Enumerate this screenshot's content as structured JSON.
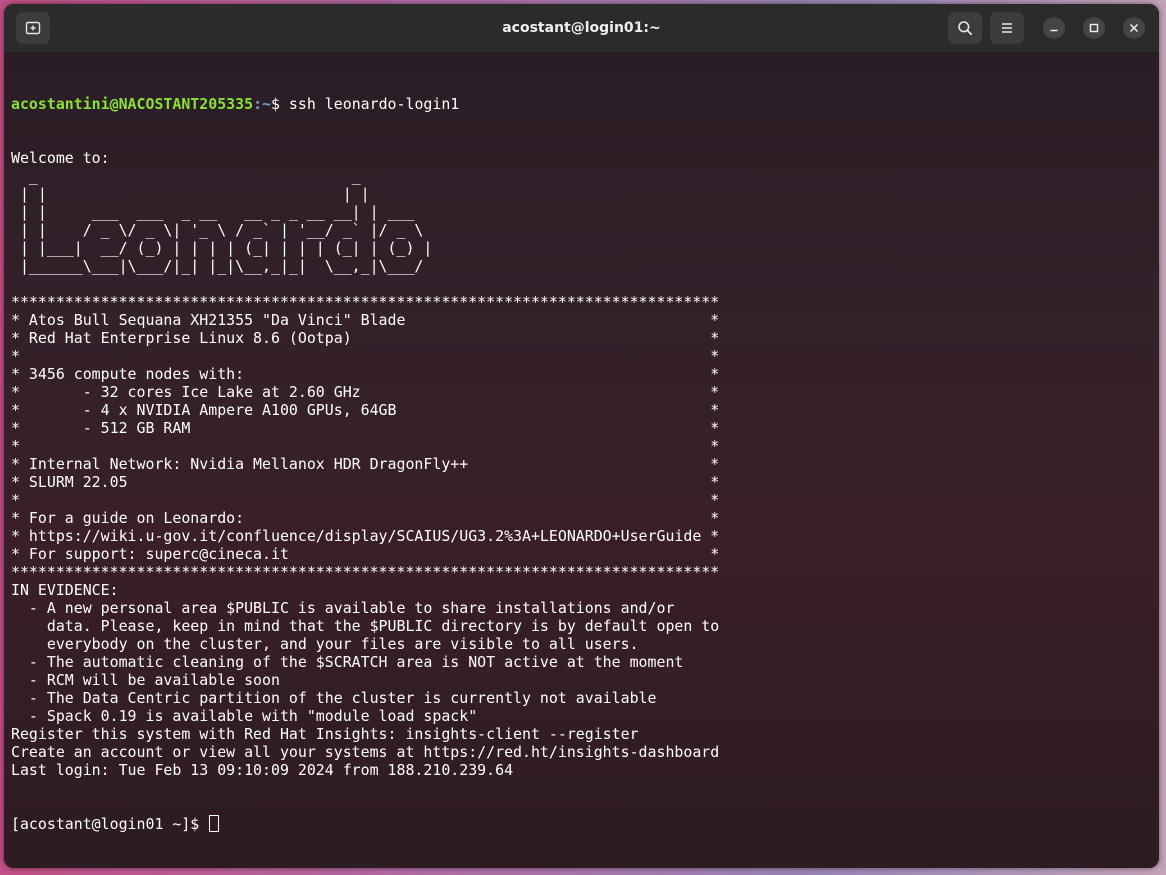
{
  "window": {
    "title": "acostant@login01:~"
  },
  "prompt": {
    "user_host": "acostantini@NACOSTANT205335",
    "path": ":~",
    "symbol": "$",
    "command": " ssh leonardo-login1"
  },
  "output_lines": [
    "Welcome to:",
    "  _                                   _",
    " | |                                 | |",
    " | |     ___  ___  _ __   __ _ _ __ __| | ___",
    " | |    / _ \\/ _ \\| '_ \\ / _` | '__/ _` |/ _ \\",
    " | |___|  __/ (_) | | | | (_| | | | (_| | (_) |",
    " |______\\___|\\___/|_| |_|\\__,_|_|  \\__,_|\\___/",
    "",
    "*******************************************************************************",
    "* Atos Bull Sequana XH21355 \"Da Vinci\" Blade                                  *",
    "* Red Hat Enterprise Linux 8.6 (Ootpa)                                        *",
    "*                                                                             *",
    "* 3456 compute nodes with:                                                    *",
    "*       - 32 cores Ice Lake at 2.60 GHz                                       *",
    "*       - 4 x NVIDIA Ampere A100 GPUs, 64GB                                   *",
    "*       - 512 GB RAM                                                          *",
    "*                                                                             *",
    "* Internal Network: Nvidia Mellanox HDR DragonFly++                           *",
    "* SLURM 22.05                                                                 *",
    "*                                                                             *",
    "* For a guide on Leonardo:                                                    *",
    "* https://wiki.u-gov.it/confluence/display/SCAIUS/UG3.2%3A+LEONARDO+UserGuide *",
    "* For support: superc@cineca.it                                               *",
    "*******************************************************************************",
    "IN EVIDENCE:",
    "  - A new personal area $PUBLIC is available to share installations and/or",
    "    data. Please, keep in mind that the $PUBLIC directory is by default open to",
    "    everybody on the cluster, and your files are visible to all users.",
    "  - The automatic cleaning of the $SCRATCH area is NOT active at the moment",
    "  - RCM will be available soon",
    "  - The Data Centric partition of the cluster is currently not available",
    "  - Spack 0.19 is available with \"module load spack\"",
    "Register this system with Red Hat Insights: insights-client --register",
    "Create an account or view all your systems at https://red.ht/insights-dashboard",
    "Last login: Tue Feb 13 09:10:09 2024 from 188.210.239.64"
  ],
  "final_prompt": "[acostant@login01 ~]$ ",
  "icons": {
    "new_tab": "new-tab-icon",
    "search": "search-icon",
    "menu": "hamburger-menu-icon",
    "minimize": "minimize-icon",
    "maximize": "maximize-icon",
    "close": "close-icon"
  },
  "colors": {
    "user_host": "#8ae234",
    "path": "#729fcf",
    "text": "#ffffff",
    "titlebar": "#2b2b2b"
  }
}
